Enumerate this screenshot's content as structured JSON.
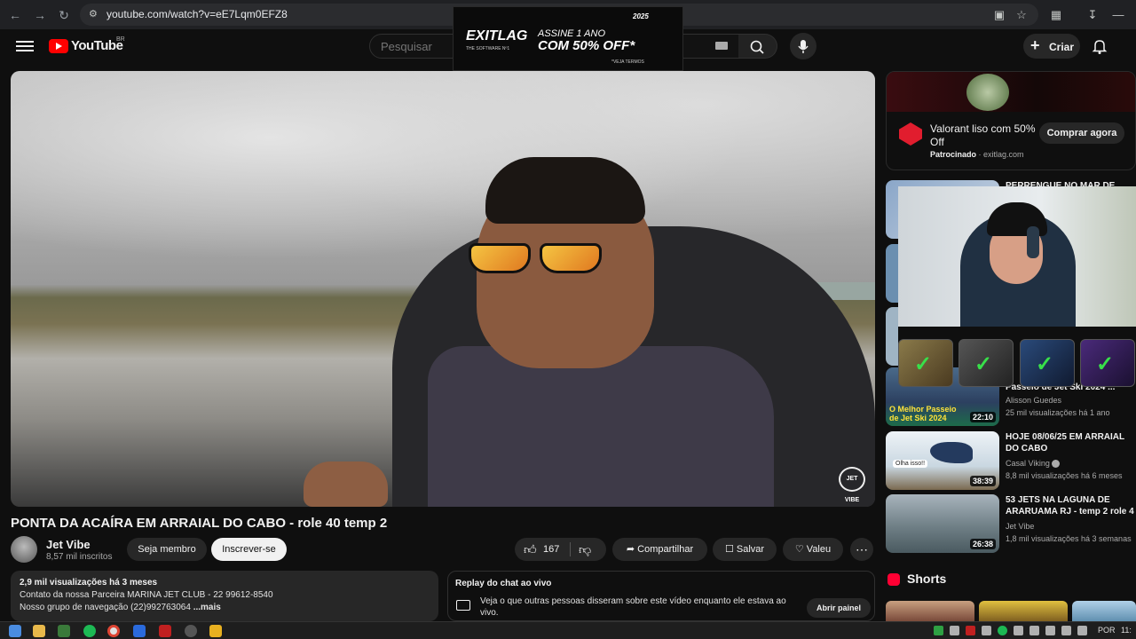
{
  "browser": {
    "url": "youtube.com/watch?v=eE7Lqm0EFZ8"
  },
  "header": {
    "logo_text": "YouTube",
    "country_code": "BR",
    "search_placeholder": "Pesquisar",
    "create_label": "Criar"
  },
  "exitlag_banner": {
    "logo": "EXITLAG",
    "subline": "THE SOFTWARE Nº1",
    "line1": "ASSINE 1 ANO",
    "line2": "COM 50% OFF*",
    "note": "*VEJA TERMOS",
    "badge": "2025"
  },
  "video": {
    "watermark": "JET VIBE",
    "title": "PONTA DA ACAÍRA EM ARRAIAL DO CABO - role 40 temp 2",
    "channel_name": "Jet Vibe",
    "channel_subs": "8,57 mil inscritos",
    "member_label": "Seja membro",
    "subscribe_label": "Inscrever-se",
    "like_count": "167",
    "share_label": "Compartilhar",
    "save_label": "Salvar",
    "thanks_label": "Valeu"
  },
  "description": {
    "stats": "2,9 mil visualizações  há 3 meses",
    "line1": "Contato da nossa Parceira MARINA JET CLUB - 22 99612-8540",
    "line2": "Nosso grupo de navegação (22)992763064 ",
    "more": "...mais"
  },
  "chat": {
    "title": "Replay do chat ao vivo",
    "text": "Veja o que outras pessoas disseram sobre este vídeo enquanto ele estava ao vivo.",
    "button": "Abrir painel"
  },
  "sidebar_ad": {
    "title": "Valorant liso com 50% Off",
    "sponsor_label": "Patrocinado",
    "sponsor_domain": "exitlag.com",
    "button": "Comprar agora"
  },
  "recommendations": [
    {
      "title": "PERRENGUE NO MAR DE",
      "channel": "",
      "meta": "",
      "duration": ""
    },
    {
      "title": "Passeio de Jet Ski 2024 ...",
      "channel": "Alisson Guedes",
      "meta": "25 mil visualizações  há 1 ano",
      "duration": "22:10",
      "thumb_text": "O Melhor Passeio de Jet Ski 2024"
    },
    {
      "title": "HOJE 08/06/25 EM ARRAIAL DO CABO",
      "channel": "Casal Viking",
      "meta": "8,8 mil visualizações  há 6 meses",
      "duration": "38:39",
      "thumb_text": "Olha isso!!"
    },
    {
      "title": "53 JETS NA LAGUNA DE ARARUAMA RJ - temp 2 role 4",
      "channel": "Jet Vibe",
      "meta": "1,8 mil visualizações  há 3 semanas",
      "duration": "26:38"
    }
  ],
  "shorts": {
    "label": "Shorts"
  },
  "taskbar": {
    "lang": "POR",
    "time": "11:"
  },
  "colors": {
    "background": "#0f0f0f",
    "youtube_red": "#ff0000",
    "check_green": "#38e04a"
  }
}
